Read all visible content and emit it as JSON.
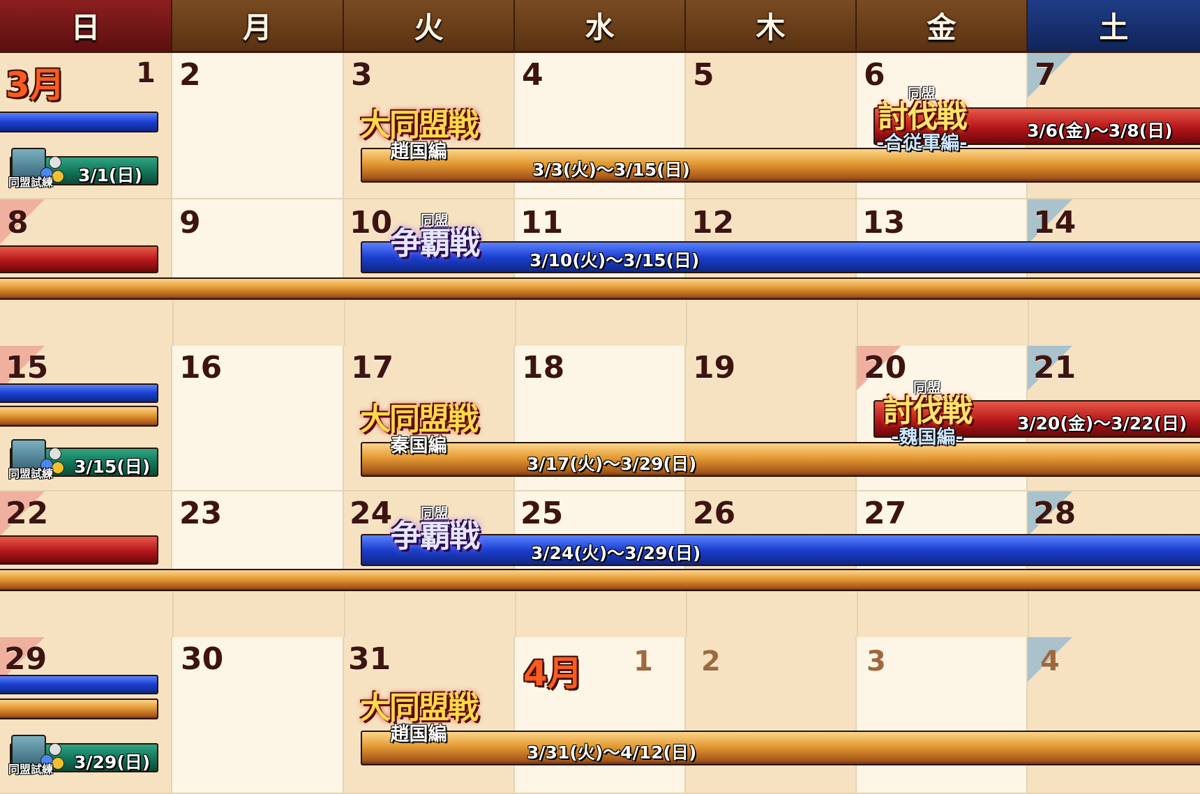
{
  "weekdays": [
    "日",
    "月",
    "火",
    "水",
    "木",
    "金",
    "土"
  ],
  "months": {
    "march": "3月",
    "april": "4月"
  },
  "week1": [
    "1",
    "2",
    "3",
    "4",
    "5",
    "6",
    "7"
  ],
  "week2": [
    "8",
    "9",
    "10",
    "11",
    "12",
    "13",
    "14"
  ],
  "week3": [
    "15",
    "16",
    "17",
    "18",
    "19",
    "20",
    "21"
  ],
  "week4": [
    "22",
    "23",
    "24",
    "25",
    "26",
    "27",
    "28"
  ],
  "week5": [
    "29",
    "30",
    "31",
    "1",
    "2",
    "3",
    "4"
  ],
  "logos": {
    "daidoumeisen": "大同盟戦",
    "zhao": "趙国編",
    "qin": "秦国編",
    "alliance": "同盟",
    "soha": "争覇戦",
    "tobatsu": "討伐戦",
    "gasshou": "-合従軍編-",
    "gi": "-魏国編-",
    "trial": "同盟試練"
  },
  "events": {
    "trial1": "3/1(日)",
    "daidou1": "3/3(火)～3/15(日)",
    "tobatsu1": "3/6(金)～3/8(日)",
    "soha1": "3/10(火)～3/15(日)",
    "trial2": "3/15(日)",
    "daidou2": "3/17(火)～3/29(日)",
    "tobatsu2": "3/20(金)～3/22(日)",
    "soha2": "3/24(火)～3/29(日)",
    "trial3": "3/29(日)",
    "daidou3": "3/31(火)～4/12(日)"
  },
  "colors": {
    "sunday_header": "#8c1f1f",
    "weekday_header": "#7a4b22",
    "saturday_header": "#1f3d86",
    "gold_bar": "#e49a33",
    "blue_bar": "#1b3fcf",
    "red_bar": "#b4161a",
    "green_bar": "#127356"
  }
}
